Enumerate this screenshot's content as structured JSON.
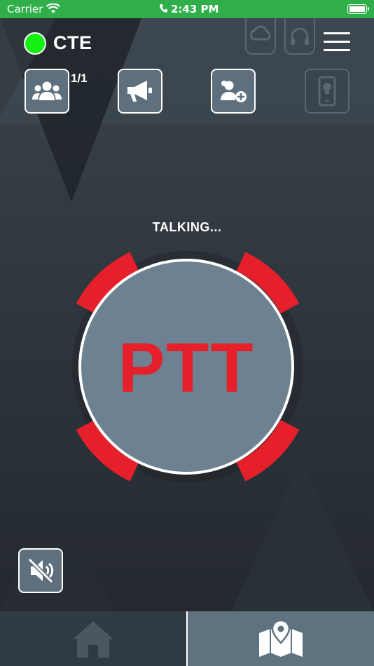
{
  "status_bar": {
    "carrier": "Carrier",
    "time": "2:43 PM"
  },
  "header": {
    "org": "CTE",
    "presence_color": "#14f014",
    "group_count": "1/1"
  },
  "toolbar": {
    "buttons": [
      {
        "name": "group-members",
        "icon": "users-icon",
        "enabled": true
      },
      {
        "name": "broadcast",
        "icon": "megaphone-icon",
        "enabled": true
      },
      {
        "name": "add-user",
        "icon": "user-plus-icon",
        "enabled": true
      },
      {
        "name": "device",
        "icon": "phone-icon",
        "enabled": false
      }
    ]
  },
  "ptt": {
    "status": "TALKING...",
    "label": "PTT",
    "accent": "#e5202a"
  },
  "tabs": [
    {
      "name": "home",
      "icon": "home-icon",
      "active": false
    },
    {
      "name": "map",
      "icon": "map-icon",
      "active": true
    }
  ]
}
